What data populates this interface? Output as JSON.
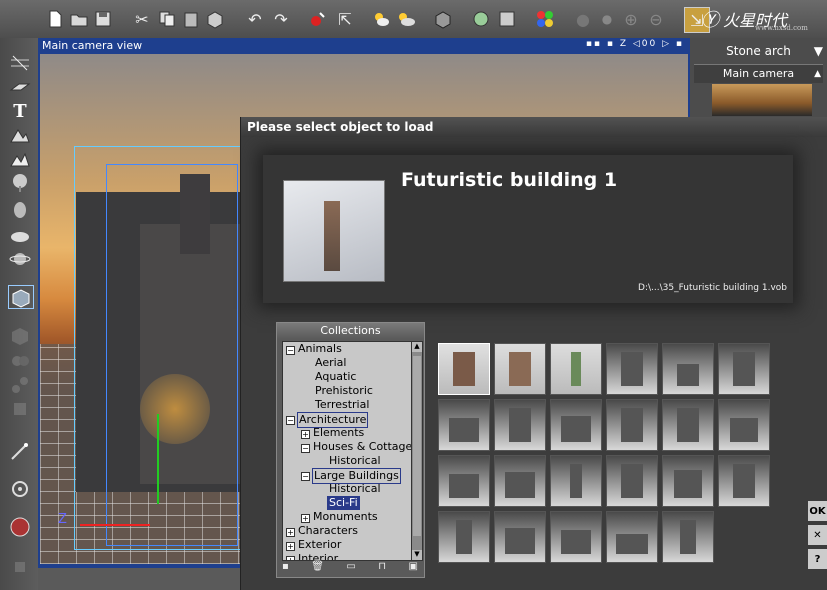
{
  "toolbar": {
    "brand": "火星时代",
    "brand_sub": "www.hxsd.com",
    "buttons": [
      "new-file-icon",
      "open-folder-icon",
      "save-icon",
      "cut-icon",
      "copy-icon",
      "paste-icon",
      "box-icon",
      "undo-icon",
      "redo-icon",
      "render-icon",
      "pointer-icon",
      "sun-cloud-icon",
      "cloud-icon",
      "cube-help-icon",
      "brush-icon",
      "select-icon",
      "color-icon",
      "gray-dot-icon",
      "circle-icon",
      "plus-icon",
      "minus-icon",
      "swap-icon"
    ]
  },
  "viewport": {
    "title": "Main camera view",
    "icons": "▪▪ ▪ Z ◁00 ▷ ▪"
  },
  "right_panel": {
    "stone_arch": "Stone arch",
    "main_camera": "Main camera"
  },
  "dialog": {
    "title": "Please select object to load",
    "object_name": "Futuristic building 1",
    "object_path": "D:\\...\\35_Futuristic building 1.vob",
    "collections_label": "Collections",
    "tree": [
      {
        "label": "Animals",
        "level": 0,
        "expander": "−"
      },
      {
        "label": "Aerial",
        "level": 1
      },
      {
        "label": "Aquatic",
        "level": 1
      },
      {
        "label": "Prehistoric",
        "level": 1
      },
      {
        "label": "Terrestrial",
        "level": 1
      },
      {
        "label": "Architecture",
        "level": 0,
        "expander": "−"
      },
      {
        "label": "Elements",
        "level": 1,
        "expander": "+"
      },
      {
        "label": "Houses & Cottages",
        "level": 1,
        "expander": "−"
      },
      {
        "label": "Historical",
        "level": 2
      },
      {
        "label": "Large Buildings",
        "level": 1,
        "expander": "−"
      },
      {
        "label": "Historical",
        "level": 2
      },
      {
        "label": "Sci-Fi",
        "level": 2
      },
      {
        "label": "Monuments",
        "level": 1,
        "expander": "+"
      },
      {
        "label": "Characters",
        "level": 0,
        "expander": "+"
      },
      {
        "label": "Exterior",
        "level": 0,
        "expander": "+"
      },
      {
        "label": "Interior",
        "level": 0,
        "expander": "+"
      }
    ],
    "thumbnail_count": 23,
    "side_buttons": {
      "ok": "OK",
      "cancel": "✕",
      "help": "?"
    }
  }
}
